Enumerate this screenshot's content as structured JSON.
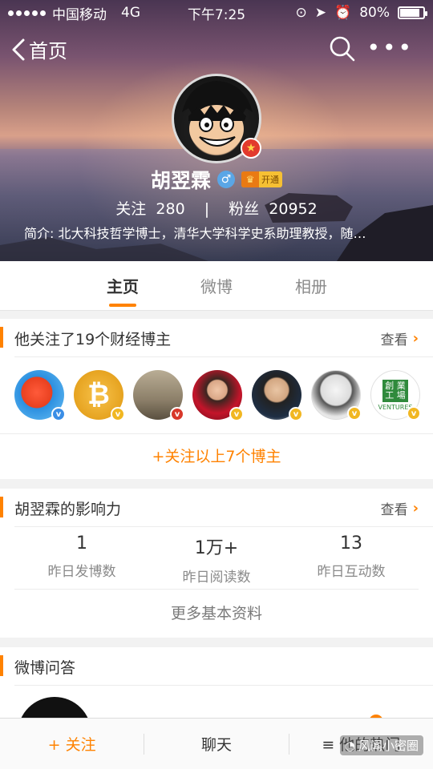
{
  "status_bar": {
    "carrier": "中国移动",
    "network": "4G",
    "time": "下午7:25",
    "battery": "80%",
    "battery_level": 0.8
  },
  "nav": {
    "back_label": "首页",
    "icons": [
      "chevron-left-icon",
      "search-icon",
      "more-dots-icon"
    ]
  },
  "profile": {
    "name": "胡翌霖",
    "vip_label": "开通",
    "following_label": "关注",
    "following_count": "280",
    "stats_separator": "|",
    "fans_label": "粉丝",
    "fans_count": "20952",
    "bio": "简介: 北大科技哲学博士，清华大学科学史系助理教授，随…"
  },
  "tabs": [
    {
      "label": "主页",
      "active": true
    },
    {
      "label": "微博",
      "active": false
    },
    {
      "label": "相册",
      "active": false
    }
  ],
  "following_card": {
    "title": "他关注了19个财经博主",
    "more_label": "查看",
    "follow_all_label": "+关注以上7个博主",
    "accounts": [
      {
        "icon": "sina-news-avatar",
        "badge": "blue"
      },
      {
        "icon": "bitcoin-avatar",
        "badge": "gold"
      },
      {
        "icon": "cathedral-avatar",
        "badge": "red"
      },
      {
        "icon": "woman-avatar",
        "badge": "gold"
      },
      {
        "icon": "man-glasses-avatar",
        "badge": "gold"
      },
      {
        "icon": "man-sketch-avatar",
        "badge": "gold"
      },
      {
        "icon": "ventures-lab-avatar",
        "badge": "gold",
        "text_top": "創 業\n工 場",
        "text_bottom": "VENTURES"
      }
    ]
  },
  "influence_card": {
    "title": "胡翌霖的影响力",
    "more_label": "查看",
    "stats": [
      {
        "value": "1",
        "label": "昨日发博数"
      },
      {
        "value": "1万+",
        "label": "昨日阅读数"
      },
      {
        "value": "13",
        "label": "昨日互动数"
      }
    ],
    "more_info_label": "更多基本资料"
  },
  "qa_card": {
    "title": "微博问答"
  },
  "bottom_bar": {
    "follow_label": "+ 关注",
    "chat_label": "聊天",
    "hot_label": "≡ 他的热门"
  },
  "watermark": "风闻小密圈",
  "colors": {
    "accent": "#ff8200",
    "text": "#333333",
    "muted": "#8a8a8a"
  }
}
